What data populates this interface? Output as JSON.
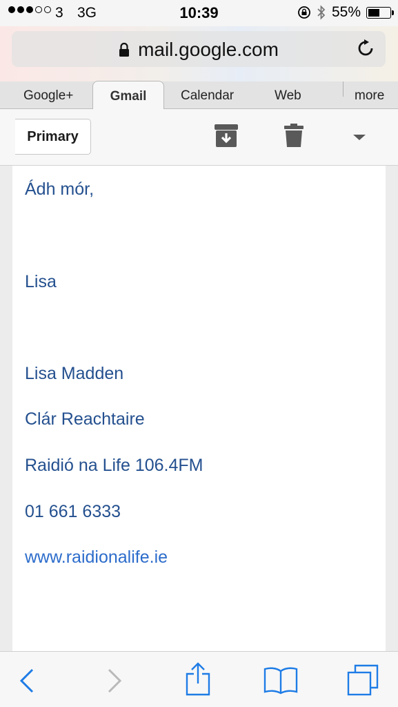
{
  "status_bar": {
    "carrier": "3",
    "network": "3G",
    "time": "10:39",
    "battery_percent_label": "55%",
    "battery_level": 0.55,
    "signal_bars_filled": 3,
    "signal_bars_total": 5
  },
  "browser": {
    "url": "mail.google.com",
    "icons": {
      "lock": "lock-icon",
      "reload": "reload-icon"
    }
  },
  "tabs": [
    {
      "label": "Google+"
    },
    {
      "label": "Gmail",
      "active": true
    },
    {
      "label": "Calendar"
    },
    {
      "label": "Web"
    },
    {
      "label": "more"
    }
  ],
  "toolbar": {
    "back_label": "Primary",
    "icons": [
      "archive-icon",
      "trash-icon",
      "dropdown-icon"
    ]
  },
  "email": {
    "lines": [
      "Ádh mór,",
      "Lisa",
      "Lisa Madden",
      "Clár Reachtaire",
      "Raidió na Life 106.4FM",
      "01 661 6333",
      "www.raidionalife.ie"
    ],
    "text_color": "#24508f",
    "link_color": "#2c6ccb"
  },
  "bottom_bar": {
    "icons": [
      "back-arrow-icon",
      "forward-arrow-icon",
      "share-icon",
      "bookmarks-icon",
      "tabs-icon"
    ],
    "accent": "#1e7ce6"
  }
}
